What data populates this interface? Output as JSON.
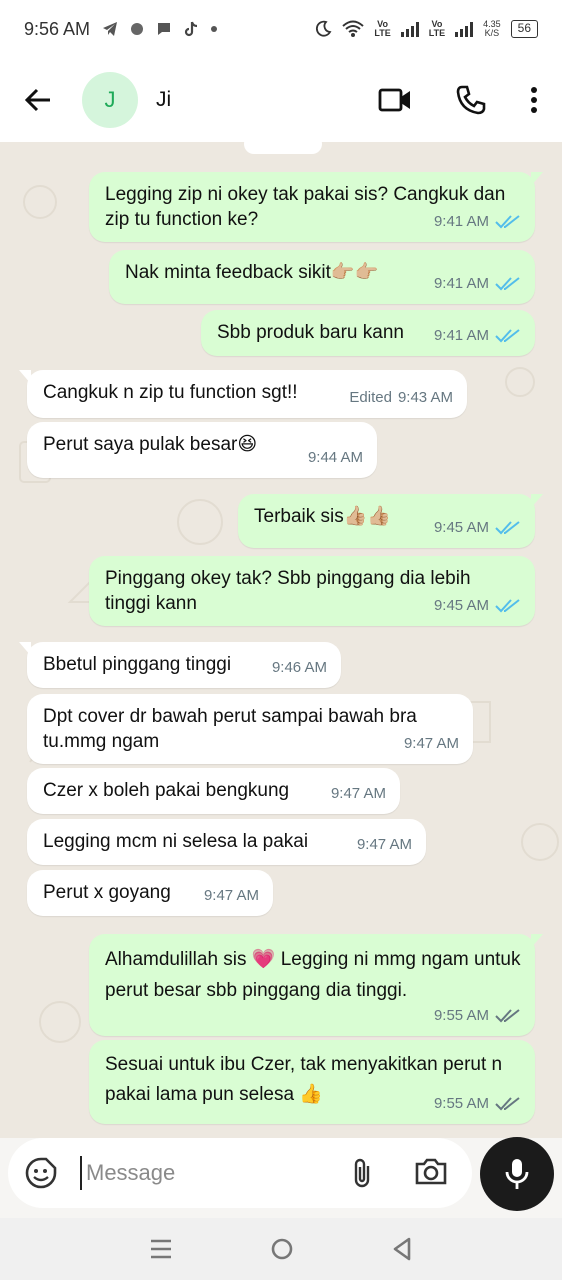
{
  "status_bar": {
    "time": "9:56 AM",
    "net1": [
      "Vo",
      "LTE"
    ],
    "net2": [
      "Vo",
      "LTE"
    ],
    "speed": [
      "4.35",
      "K/S"
    ],
    "battery": "56"
  },
  "header": {
    "avatar_initial": "J",
    "contact_name": "Ji",
    "icons": [
      "back-arrow-icon",
      "video-call-icon",
      "voice-call-icon",
      "more-vert-icon"
    ]
  },
  "messages": [
    {
      "dir": "out",
      "text": "Legging zip ni okey tak pakai sis? Cangkuk dan zip tu function ke?",
      "time": "9:41 AM",
      "status": "read"
    },
    {
      "dir": "out",
      "text": "Nak minta feedback sikit👉🏼👉🏼",
      "time": "9:41 AM",
      "status": "read"
    },
    {
      "dir": "out",
      "text": "Sbb produk baru kann",
      "time": "9:41 AM",
      "status": "read"
    },
    {
      "dir": "in",
      "text": "Cangkuk n zip tu function sgt!!",
      "edited": "Edited",
      "time": "9:43 AM"
    },
    {
      "dir": "in",
      "text": "Perut saya pulak besar😆",
      "time": "9:44 AM"
    },
    {
      "dir": "out",
      "text": "Terbaik sis👍🏼👍🏼",
      "time": "9:45 AM",
      "status": "read"
    },
    {
      "dir": "out",
      "text": "Pinggang okey tak? Sbb pinggang dia lebih tinggi kann",
      "time": "9:45 AM",
      "status": "read"
    },
    {
      "dir": "in",
      "text": "Bbetul pinggang tinggi",
      "time": "9:46 AM"
    },
    {
      "dir": "in",
      "text": "Dpt cover dr bawah perut sampai bawah bra tu.mmg ngam",
      "time": "9:47 AM"
    },
    {
      "dir": "in",
      "text": "Czer x boleh pakai bengkung",
      "time": "9:47 AM"
    },
    {
      "dir": "in",
      "text": "Legging mcm ni selesa la pakai",
      "time": "9:47 AM"
    },
    {
      "dir": "in",
      "text": "Perut x goyang",
      "time": "9:47 AM"
    },
    {
      "dir": "out",
      "text": "Alhamdulillah sis 💗 Legging ni mmg ngam untuk perut besar sbb pinggang dia tinggi.",
      "time": "9:55 AM",
      "status": "delivered"
    },
    {
      "dir": "out",
      "text": "Sesuai untuk ibu Czer, tak menyakitkan perut n pakai lama pun selesa 👍",
      "time": "9:55 AM",
      "status": "delivered"
    }
  ],
  "composer": {
    "placeholder": "Message",
    "icons": [
      "sticker-icon",
      "attach-icon",
      "camera-icon",
      "mic-icon"
    ]
  },
  "colors": {
    "outgoing_bubble": "#d9fdd3",
    "incoming_bubble": "#ffffff",
    "read_tick": "#53bdeb",
    "delivered_tick": "#667781",
    "avatar_bg": "#d5f5dc",
    "avatar_fg": "#1faa59"
  }
}
